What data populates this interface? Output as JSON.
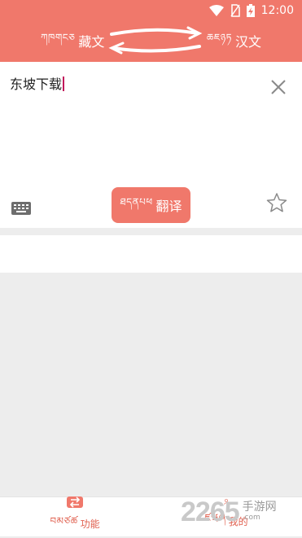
{
  "status_bar": {
    "time": "12:00"
  },
  "language_bar": {
    "source_tibetan": "ཀཁགངཅ",
    "source_label": "藏文",
    "target_tibetan": "ཆཇཉཏ",
    "target_label": "汉文"
  },
  "input": {
    "text": "东坡下载"
  },
  "translate_button": {
    "tibetan": "ཐདནཔཕ",
    "label": "翻译"
  },
  "bottom_nav": {
    "function": {
      "tibetan": "བམཙཚ",
      "label": "功能"
    },
    "mine": {
      "tibetan": "ཛཝཞ",
      "label": "我的"
    }
  },
  "watermark": {
    "number": "2265",
    "site": "手游网",
    "domain": ".com"
  },
  "colors": {
    "accent": "#f0786b",
    "nav_active": "#e0604f"
  }
}
